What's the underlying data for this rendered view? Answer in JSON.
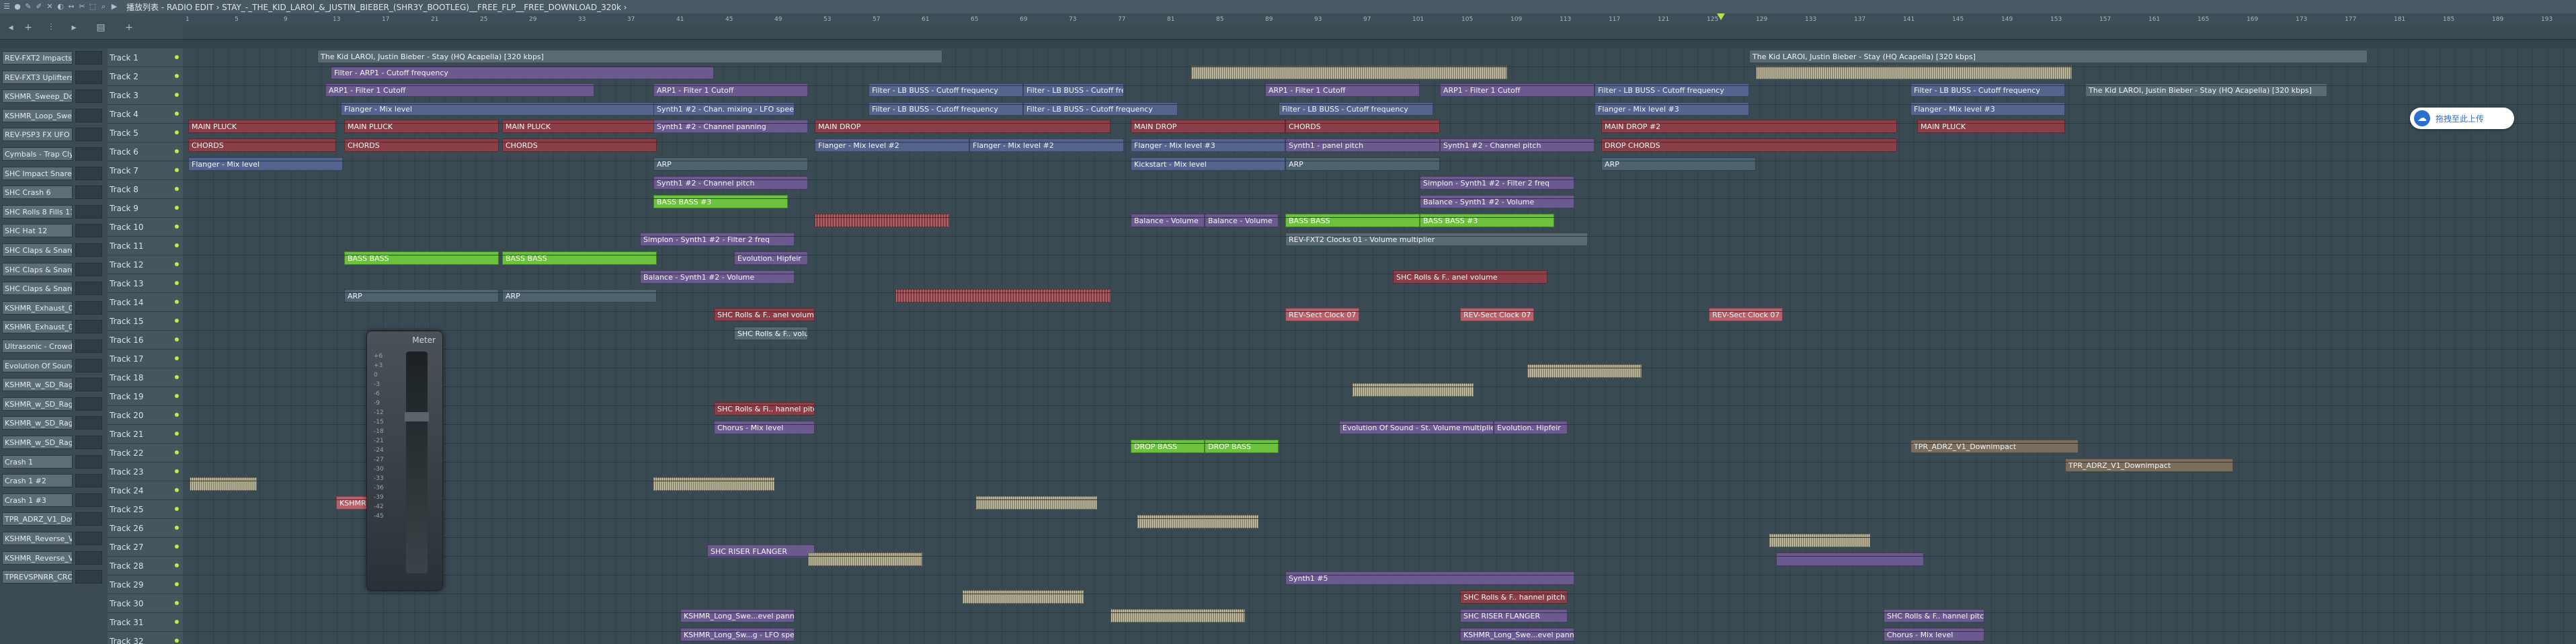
{
  "window": {
    "title": "播放列表 - RADIO EDIT › STAY_-_THE_KID_LAROI_&_JUSTIN_BIEBER_(SHR3Y_BOOTLEG)__FREE_FLP__FREE_DOWNLOAD_320k ›"
  },
  "ruler": {
    "bars": [
      "1",
      "5",
      "9",
      "13",
      "17",
      "21",
      "25",
      "29",
      "33",
      "37",
      "41",
      "45",
      "49",
      "53",
      "57",
      "61",
      "65",
      "69",
      "73",
      "77",
      "81",
      "85",
      "89",
      "93",
      "97",
      "101",
      "105",
      "109",
      "113",
      "117",
      "121",
      "125",
      "129",
      "133",
      "137",
      "141",
      "145",
      "149",
      "153",
      "157",
      "161",
      "165",
      "169",
      "173",
      "177",
      "181",
      "185",
      "189",
      "193"
    ]
  },
  "channels": [
    "REV-FXT2 Impacts 02",
    "REV-FXT3 Uplifters 08",
    "KSHMR_Sweep_Dow...",
    "KSHMR_Loop_Sweep",
    "REV-PSP3 FX UFO Rev...",
    "Cymbals - Trap Cly...",
    "SHC Impact Snare 1",
    "SHC Crash 6",
    "SHC Rolls 8 Fills 11",
    "SHC Hat 12",
    "SHC Claps & Snares 28",
    "SHC Claps & Snares 36",
    "SHC Claps & Snares 76",
    "KSHMR_Exhaust_08...",
    "KSHMR_Exhaust_08...",
    "Ultrasonic - Crowd F...",
    "Evolution Of Sound - ...",
    "KSHMR_w_SD_Ragna...",
    "KSHMR_w_SD_Ragna...",
    "KSHMR_w_SD_Ragna...",
    "KSHMR_w_SD_Ragna...",
    "Crash 1",
    "Crash 1 #2",
    "Crash 1 #3",
    "TPR_ADRZ_V1_Downlin...",
    "KSHMR_Reverse_Vo...",
    "KSHMR_Reverse_Vo...",
    "TPREVSPNRR_CROWD..."
  ],
  "tracks": [
    "Track 1",
    "Track 2",
    "Track 3",
    "Track 4",
    "Track 5",
    "Track 6",
    "Track 7",
    "Track 8",
    "Track 9",
    "Track 10",
    "Track 11",
    "Track 12",
    "Track 13",
    "Track 14",
    "Track 15",
    "Track 16",
    "Track 17",
    "Track 18",
    "Track 19",
    "Track 20",
    "Track 21",
    "Track 22",
    "Track 23",
    "Track 24",
    "Track 25",
    "Track 26",
    "Track 27",
    "Track 28",
    "Track 29",
    "Track 30",
    "Track 31",
    "Track 32"
  ],
  "clips": {
    "c1": "The Kid LAROI, Justin Bieber - Stay (HQ Acapella) [320 kbps]",
    "c2": "The Kid LAROI, Justin Bieber - Stay (HQ Acapella) [320 kbps]",
    "c3": "Filter - ARP1 - Cutoff frequency",
    "c4": "ARP1 - Filter 1 Cutoff",
    "c5": "ARP1 - Filter 1 Cutoff",
    "c6": "Filter - LB BUSS - Cutoff frequency",
    "c7": "Filter - LB BUSS - Cutoff frequency",
    "c8": "ARP1 - Filter 1 Cutoff",
    "c9": "ARP1 - Filter 1 Cutoff",
    "c10": "Filter - LB BUSS - Cutoff frequency",
    "c11": "Filter - LB BUSS - Cutoff frequency",
    "c12": "The Kid LAROI, Justin Bieber - Stay (HQ Acapella) [320 kbps]",
    "c13": "Flanger - Mix level",
    "c14": "Synth1 #2 - Chan. mixing - LFO speed",
    "c15": "Filter - LB BUSS - Cutoff frequency",
    "c16": "Filter - LB BUSS - Cutoff frequency",
    "c17": "Filter - LB BUSS - Cutoff frequency",
    "c18": "Flanger - Mix level #3",
    "c19": "Flanger - Mix level #3",
    "c20": "MAIN PLUCK",
    "c21": "MAIN PLUCK",
    "c22": "MAIN PLUCK",
    "c23": "Synth1 #2 - Channel panning",
    "c24": "MAIN DROP",
    "c25": "MAIN DROP",
    "c26": "CHORDS",
    "c27": "MAIN DROP #2",
    "c28": "MAIN PLUCK",
    "c29": "CHORDS",
    "c30": "CHORDS",
    "c31": "CHORDS",
    "c32": "Flanger - Mix level #2",
    "c33": "Flanger - Mix level #2",
    "c34": "Flanger - Mix level #3",
    "c35": "Synth1 - panel pitch",
    "c36": "Synth1 #2 - Channel pitch",
    "c37": "DROP CHORDS",
    "c38": "Flanger - Mix level",
    "c39": "ARP",
    "c40": "Kickstart - Mix level",
    "c41": "ARP",
    "c42": "ARP",
    "c43": "Synth1 #2 - Channel pitch",
    "c44": "Simplon - Synth1 #2 - Filter 2 freq",
    "c45": "BASS BASS #3",
    "c46": "Balance - Synth1 #2 - Volume",
    "c47": "Balance - Volume",
    "c48": "Balance - Volume",
    "c49": "BASS BASS",
    "c50": "BASS BASS #3",
    "c51": "Simplon - Synth1 #2 - Filter 2 freq",
    "c52": "REV-FXT2 Clocks 01 - Volume multiplier",
    "c53": "BASS BASS",
    "c54": "BASS BASS",
    "c55": "Evolution. Hipfeir",
    "c56": "Balance - Synth1 #2 - Volume",
    "c57": "SHC Rolls & F.. anel volume",
    "c58": "ARP",
    "c59": "ARP",
    "c60": "SHC Rolls & F.. anel volume",
    "c61": "REV-Sect Clock 07",
    "c62": "REV-Sect Clock 07",
    "c63": "REV-Sect Clock 07",
    "c64": "SHC Rolls & F.. volume",
    "c65": "Evolution Of Sound - St. Volume multiplier #2",
    "c66": "Evolution. Hipfeir",
    "c67": "Chorus - Mix level",
    "c68": "DROP BASS",
    "c69": "DROP BASS",
    "c70": "SHC Rolls & F.. hannel pitch",
    "c71": "Synth1 #5",
    "c72": "SHC Rolls & F.. hannel pitch",
    "c73": "SHC RISER FLANGER",
    "c74": "SHC RISER FLANGER",
    "c75": "KSHMR_Long_Swe...evel panner",
    "c76": "KSHMR_Long_Sw...g - LFO speed",
    "c77": "KSHMR_Long_Swe...evel panner",
    "c78": "SHC Rolls & Fi.. hannel pitch",
    "c79": "Chorus - Mix level",
    "c80": "TPR_ADRZ_V1_Downimpact",
    "c81": "TPR_ADRZ_V1_Downimpact",
    "c82": "KSHMR_Bamboo_Downlow..."
  },
  "meter": {
    "label": "Meter",
    "scale": [
      "+6",
      "+3",
      "0",
      "-3",
      "-6",
      "-9",
      "-12",
      "-15",
      "-18",
      "-21",
      "-24",
      "-27",
      "-30",
      "-33",
      "-36",
      "-39",
      "-42",
      "-45"
    ]
  },
  "upload_button": {
    "label": "拖拽至此上传"
  },
  "colors": {
    "background": "#34444e",
    "accent_green": "#c6e846",
    "clip_purple": "#6a5a8e",
    "clip_red": "#8a3e48",
    "clip_green": "#6cc23c"
  }
}
